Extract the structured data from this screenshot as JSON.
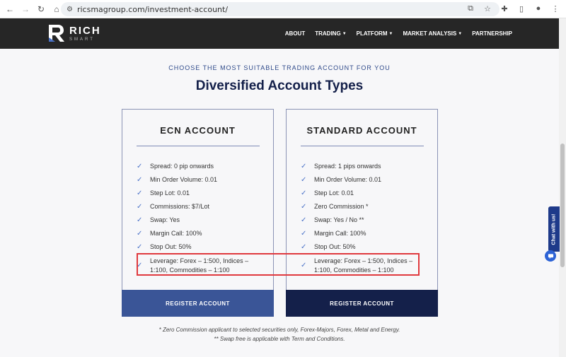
{
  "browser": {
    "url": "ricsmagroup.com/investment-account/"
  },
  "header": {
    "logo_line1": "RICH",
    "logo_line2": "SMART",
    "menu": [
      {
        "label": "ABOUT",
        "has_caret": false
      },
      {
        "label": "TRADING",
        "has_caret": true
      },
      {
        "label": "PLATFORM",
        "has_caret": true
      },
      {
        "label": "MARKET ANALYSIS",
        "has_caret": true
      },
      {
        "label": "PARTNERSHIP",
        "has_caret": false
      }
    ]
  },
  "main": {
    "subtitle": "CHOOSE THE MOST SUITABLE TRADING ACCOUNT FOR YOU",
    "title": "Diversified Account Types",
    "accounts": [
      {
        "title": "ECN ACCOUNT",
        "features": [
          "Spread: 0 pip onwards",
          "Min Order Volume: 0.01",
          "Step Lot: 0.01",
          "Commissions: $7/Lot",
          "Swap: Yes",
          "Margin Call: 100%",
          "Stop Out: 50%",
          "Leverage: Forex – 1:500, Indices – 1:100, Commodities – 1:100"
        ],
        "button": "REGISTER ACCOUNT"
      },
      {
        "title": "STANDARD ACCOUNT",
        "features": [
          "Spread: 1 pips onwards",
          "Min Order Volume: 0.01",
          "Step Lot: 0.01",
          "Zero Commission *",
          "Swap: Yes / No **",
          "Margin Call: 100%",
          "Stop Out: 50%",
          "Leverage: Forex – 1:500, Indices – 1:100, Commodities – 1:100"
        ],
        "button": "REGISTER ACCOUNT"
      }
    ],
    "note1": "* Zero Commission applicant to selected securities only, Forex-Majors, Forex, Metal and Energy.",
    "note2": "** Swap free is applicable with Term and Conditions."
  },
  "chat": {
    "label": "Chat with us!"
  },
  "colors": {
    "header_bg": "#262626",
    "accent_blue": "#3a5597",
    "navy": "#14204a",
    "check": "#4c73c8",
    "highlight_red": "#e0393e"
  },
  "icons": [
    "back-icon",
    "forward-icon",
    "reload-icon",
    "home-icon",
    "site-info-icon",
    "translate-icon",
    "star-icon",
    "extensions-icon",
    "sidebar-icon",
    "profile-icon",
    "menu-icon",
    "check-icon",
    "chat-icon"
  ]
}
